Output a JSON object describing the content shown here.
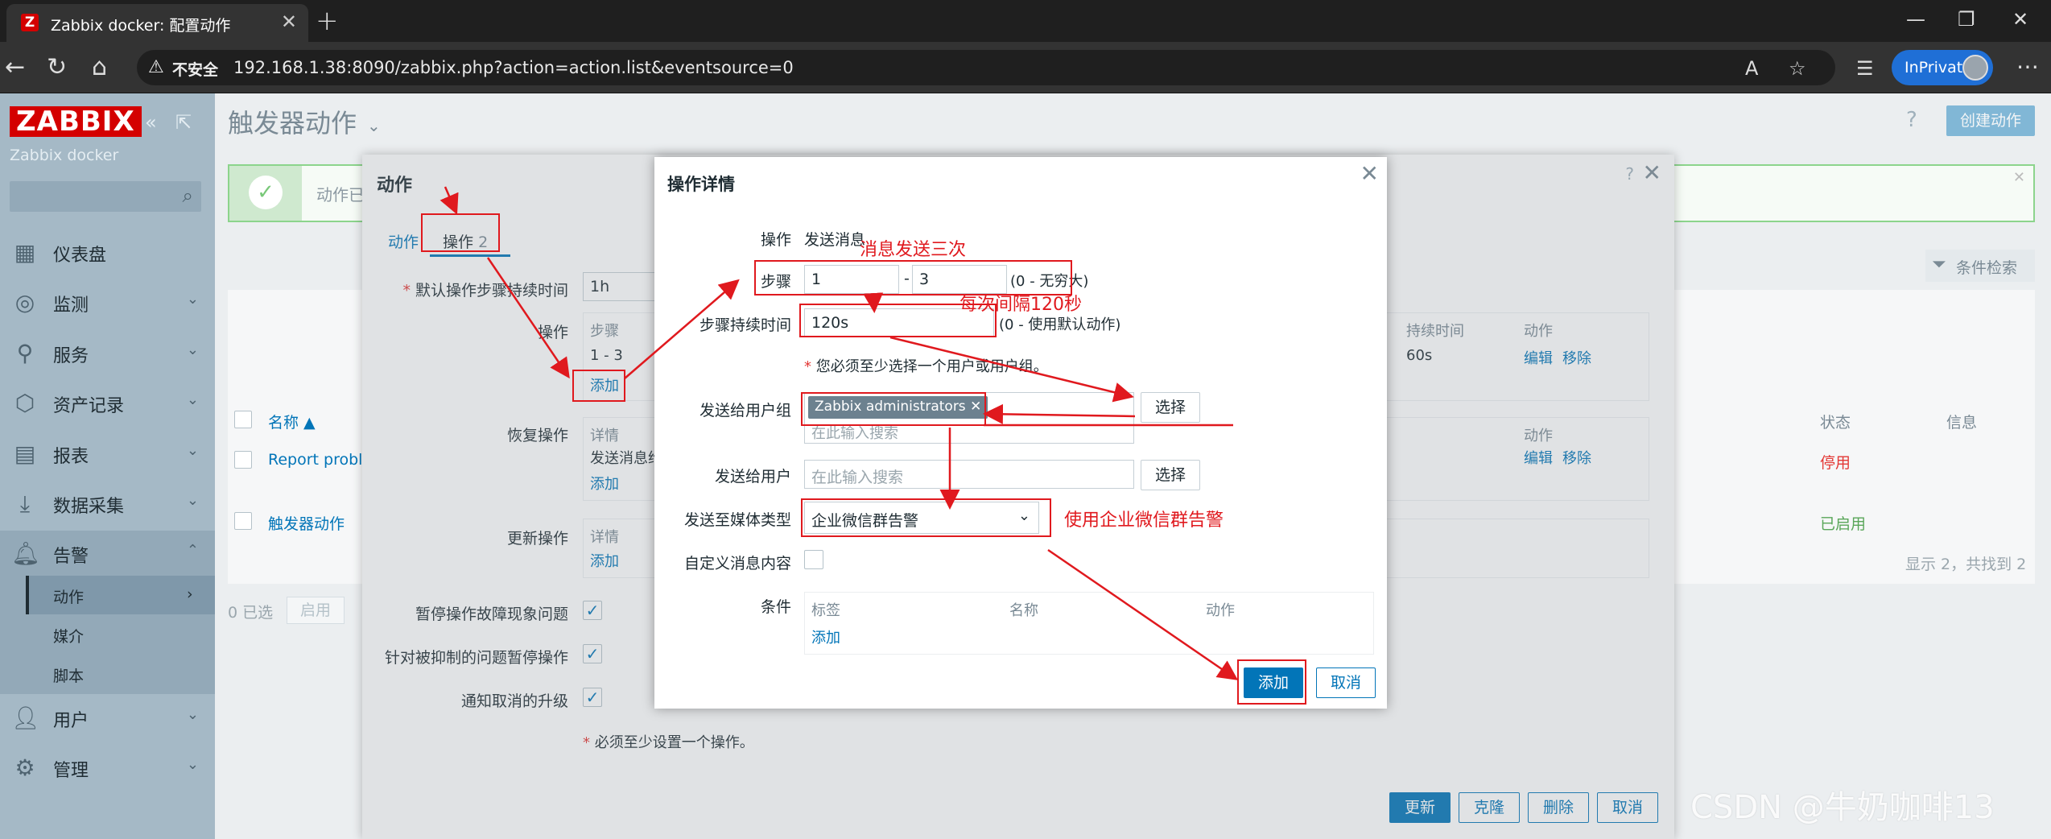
{
  "browser": {
    "tab_title": "Zabbix docker: 配置动作",
    "favicon_letter": "Z",
    "insecure_label": "不安全",
    "url": "192.168.1.38:8090/zabbix.php?action=action.list&eventsource=0",
    "inprivate_label": "InPrivate"
  },
  "sidebar": {
    "logo": "ZABBIX",
    "server_name": "Zabbix docker",
    "menu": [
      {
        "label": "仪表盘",
        "icon": "dashboard-icon"
      },
      {
        "label": "监测",
        "icon": "monitoring-icon"
      },
      {
        "label": "服务",
        "icon": "services-icon"
      },
      {
        "label": "资产记录",
        "icon": "inventory-icon"
      },
      {
        "label": "报表",
        "icon": "reports-icon"
      },
      {
        "label": "数据采集",
        "icon": "data-collection-icon"
      },
      {
        "label": "告警",
        "icon": "alerts-icon"
      },
      {
        "label": "用户",
        "icon": "users-icon"
      },
      {
        "label": "管理",
        "icon": "administration-icon"
      }
    ],
    "submenu": [
      {
        "label": "动作"
      },
      {
        "label": "媒介"
      },
      {
        "label": "脚本"
      }
    ]
  },
  "main": {
    "page_title": "触发器动作",
    "create_button": "创建动作",
    "success_text": "动作已",
    "filter_label": "条件检索",
    "table": {
      "col_name": "名称 ▲",
      "col_status": "状态",
      "col_info": "信息",
      "rows": [
        {
          "name": "Report problem",
          "status": "停用"
        },
        {
          "name": "触发器动作",
          "status": "已启用"
        }
      ],
      "footer_count": "显示 2，共找到 2",
      "selected": "0 已选",
      "enable_button": "启用"
    }
  },
  "action_modal": {
    "title": "动作",
    "tab_action": "动作",
    "tab_operations": "操作",
    "tab_operations_count": "2",
    "default_step_label": "默认操作步骤持续时间",
    "default_step_value": "1h",
    "operations_label": "操作",
    "op_head_steps": "步骤",
    "op_head_duration": "持续时间",
    "op_head_action": "动作",
    "op_row_steps": "1 - 3",
    "op_row_duration": "60s",
    "op_edit": "编辑",
    "op_remove": "移除",
    "add_link": "添加",
    "recovery_label": "恢复操作",
    "recovery_head_details": "详情",
    "recovery_head_action": "动作",
    "recovery_row_details": "发送消息给",
    "recovery_edit": "编辑",
    "recovery_remove": "移除",
    "update_label": "更新操作",
    "update_head_details": "详情",
    "pause_suppressed_label": "暂停操作故障现象问题",
    "pause_symptoms_label": "针对被抑制的问题暂停操作",
    "notify_canceled_label": "通知取消的升级",
    "must_have_op": "必须至少设置一个操作。",
    "btn_update": "更新",
    "btn_clone": "克隆",
    "btn_delete": "删除",
    "btn_cancel": "取消"
  },
  "op_detail": {
    "title": "操作详情",
    "operation_label": "操作",
    "operation_value": "发送消息",
    "steps_label": "步骤",
    "step_from": "1",
    "step_to": "3",
    "step_hint": "(0 - 无穷大)",
    "step_duration_label": "步骤持续时间",
    "step_duration_value": "120s",
    "step_duration_hint": "(0 - 使用默认动作)",
    "must_select_hint": "您必须至少选择一个用户或用户组。",
    "send_to_groups_label": "发送给用户组",
    "group_chip": "Zabbix administrators",
    "search_placeholder": "在此输入搜索",
    "select_button": "选择",
    "send_to_users_label": "发送给用户",
    "media_type_label": "发送至媒体类型",
    "media_type_value": "企业微信群告警",
    "custom_message_label": "自定义消息内容",
    "conditions_label": "条件",
    "cond_head_label": "标签",
    "cond_head_name": "名称",
    "cond_head_action": "动作",
    "cond_add": "添加",
    "btn_add": "添加",
    "btn_cancel": "取消"
  },
  "annotations": {
    "send_three_times": "消息发送三次",
    "interval_120": "每次间隔120秒",
    "use_wechat": "使用企业微信群告警"
  },
  "watermark": "CSDN @牛奶咖啡13",
  "colors": {
    "accent": "#0275b8",
    "annotation": "#e0191e",
    "sidebar": "#a5b9c6",
    "brand": "#d40000"
  }
}
